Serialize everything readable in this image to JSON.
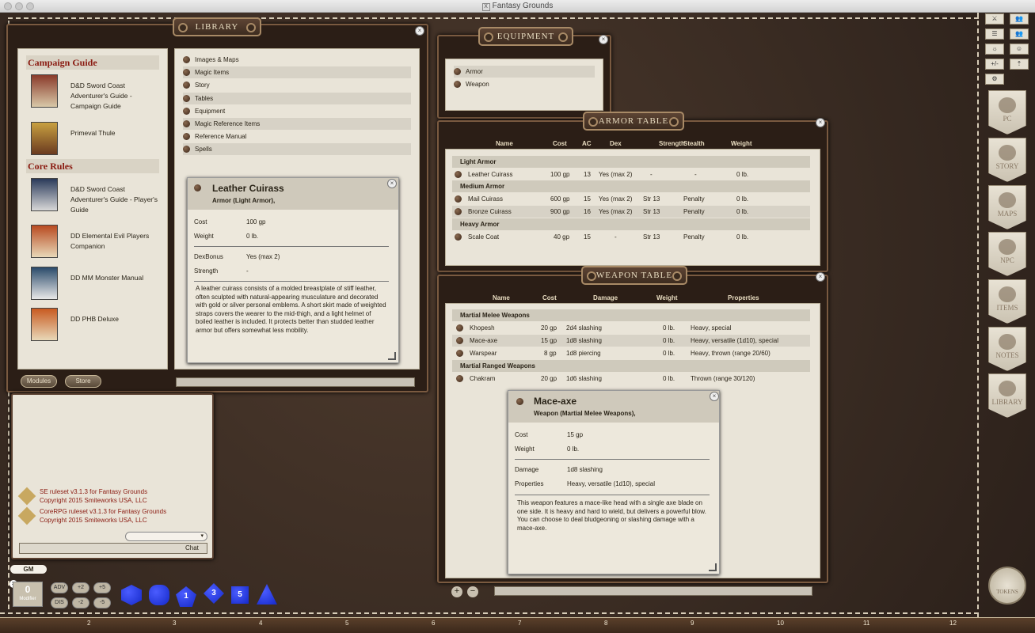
{
  "window": {
    "title": "Fantasy Grounds"
  },
  "library": {
    "title": "LIBRARY",
    "sections": [
      {
        "heading": "Campaign Guide",
        "modules": [
          "D&D Sword Coast Adventurer's Guide - Campaign Guide",
          "Primeval Thule"
        ]
      },
      {
        "heading": "Core Rules",
        "modules": [
          "D&D Sword Coast Adventurer's Guide - Player's Guide",
          "DD Elemental Evil Players Companion",
          "DD MM Monster Manual",
          "DD PHB Deluxe"
        ]
      }
    ],
    "categories": [
      "Images & Maps",
      "Magic Items",
      "Story",
      "Tables",
      "Equipment",
      "Magic Reference Items",
      "Reference Manual",
      "Spells"
    ],
    "modules_btn": "Modules",
    "store_btn": "Store"
  },
  "leather": {
    "name": "Leather Cuirass",
    "type": "Armor (Light Armor),",
    "cost_label": "Cost",
    "cost": "100 gp",
    "weight_label": "Weight",
    "weight": "0 lb.",
    "dex_label": "DexBonus",
    "dex": "Yes (max 2)",
    "str_label": "Strength",
    "str": "-",
    "desc": "A leather cuirass consists of a molded breastplate of stiff leather, often sculpted with natural-appearing musculature and decorated with gold or silver personal emblems. A short skirt made of weighted straps covers the wearer to the mid-thigh, and a light helmet of boiled leather is included. It protects better than studded leather armor but offers somewhat less mobility."
  },
  "equipment": {
    "title": "EQUIPMENT",
    "items": [
      "Armor",
      "Weapon"
    ]
  },
  "armor": {
    "title": "ARMOR TABLE",
    "columns": [
      "Name",
      "Cost",
      "AC",
      "Dex",
      "Strength",
      "Stealth",
      "Weight"
    ],
    "groups": [
      {
        "name": "Light Armor",
        "rows": [
          [
            "Leather Cuirass",
            "100 gp",
            "13",
            "Yes (max 2)",
            "-",
            "-",
            "0 lb."
          ]
        ]
      },
      {
        "name": "Medium Armor",
        "rows": [
          [
            "Mail Cuirass",
            "600 gp",
            "15",
            "Yes (max 2)",
            "Str 13",
            "Penalty",
            "0 lb."
          ],
          [
            "Bronze Cuirass",
            "900 gp",
            "16",
            "Yes (max 2)",
            "Str 13",
            "Penalty",
            "0 lb."
          ]
        ]
      },
      {
        "name": "Heavy Armor",
        "rows": [
          [
            "Scale Coat",
            "40 gp",
            "15",
            "-",
            "Str 13",
            "Penalty",
            "0 lb."
          ]
        ]
      }
    ]
  },
  "weapon": {
    "title": "WEAPON TABLE",
    "columns": [
      "Name",
      "Cost",
      "Damage",
      "Weight",
      "Properties"
    ],
    "groups": [
      {
        "name": "Martial Melee Weapons",
        "rows": [
          [
            "Khopesh",
            "20 gp",
            "2d4 slashing",
            "0 lb.",
            "Heavy, special"
          ],
          [
            "Mace-axe",
            "15 gp",
            "1d8 slashing",
            "0 lb.",
            "Heavy, versatile (1d10), special"
          ],
          [
            "Warspear",
            "8 gp",
            "1d8 piercing",
            "0 lb.",
            "Heavy, thrown (range 20/60)"
          ]
        ]
      },
      {
        "name": "Martial Ranged Weapons",
        "rows": [
          [
            "Chakram",
            "20 gp",
            "1d6 slashing",
            "0 lb.",
            "Thrown (range 30/120)"
          ]
        ]
      }
    ]
  },
  "mace": {
    "name": "Mace-axe",
    "type": "Weapon (Martial Melee Weapons),",
    "cost_label": "Cost",
    "cost": "15 gp",
    "weight_label": "Weight",
    "weight": "0 lb.",
    "damage_label": "Damage",
    "damage": "1d8 slashing",
    "props_label": "Properties",
    "props": "Heavy, versatile (1d10), special",
    "desc": "This weapon features a mace-like head with a single axe blade on one side. It is heavy and hard to wield, but delivers a powerful blow. You can choose to deal bludgeoning or slashing damage with a mace-axe."
  },
  "chat": {
    "lines": [
      [
        "SE ruleset v3.1.3 for Fantasy Grounds",
        "Copyright 2015 Smiteworks USA, LLC"
      ],
      [
        "CoreRPG ruleset v3.1.3 for Fantasy Grounds",
        "Copyright 2015 Smiteworks USA, LLC"
      ]
    ],
    "chat_btn": "Chat"
  },
  "gm": "GM",
  "modifier": {
    "value": "0",
    "label": "Modifier"
  },
  "mods": [
    "ADV",
    "+2",
    "+5",
    "DIS",
    "-2",
    "-5"
  ],
  "dice": [
    "",
    "",
    "1",
    "3",
    "5",
    ""
  ],
  "sidebar": [
    "PC",
    "STORY",
    "MAPS",
    "NPC",
    "ITEMS",
    "NOTES",
    "LIBRARY"
  ],
  "tokens": "TOKENS",
  "tools": [
    "⚔",
    "👥",
    "☰",
    "👥",
    "☼",
    "☺",
    "+/-",
    "⇡",
    "⚙"
  ],
  "ruler": [
    "2",
    "3",
    "4",
    "5",
    "6",
    "7",
    "8",
    "9",
    "10",
    "11",
    "12"
  ]
}
